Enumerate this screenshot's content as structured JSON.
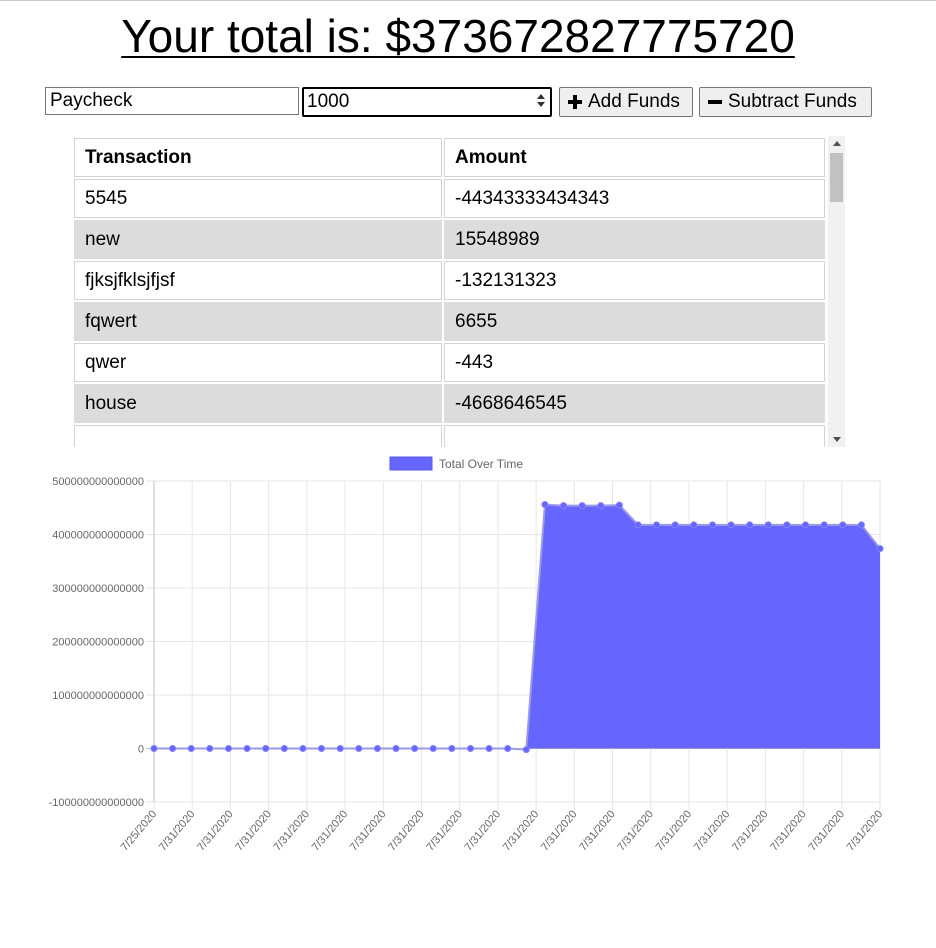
{
  "header": {
    "total_text": "Your total is: $373672827775720"
  },
  "form": {
    "name_value": "Paycheck",
    "amount_value": "1000",
    "add_label": "Add Funds",
    "subtract_label": "Subtract Funds"
  },
  "table": {
    "headers": [
      "Transaction",
      "Amount"
    ],
    "rows": [
      {
        "name": "5545",
        "amount": "-44343333434343"
      },
      {
        "name": "new",
        "amount": "15548989"
      },
      {
        "name": "fjksjfklsjfjsf",
        "amount": "-132131323"
      },
      {
        "name": "fqwert",
        "amount": "6655"
      },
      {
        "name": "qwer",
        "amount": "-443"
      },
      {
        "name": "house",
        "amount": "-4668646545"
      },
      {
        "name": "",
        "amount": ""
      }
    ]
  },
  "chart_data": {
    "type": "area",
    "legend": "Total Over Time",
    "legend_position": "top",
    "fill_color": "#6666ff",
    "ylim": [
      -100000000000000,
      500000000000000
    ],
    "yticks": [
      "500000000000000",
      "400000000000000",
      "300000000000000",
      "200000000000000",
      "100000000000000",
      "0",
      "-100000000000000"
    ],
    "x": [
      "7/25/2020",
      "7/31/2020",
      "7/31/2020",
      "7/31/2020",
      "7/31/2020",
      "7/31/2020",
      "7/31/2020",
      "7/31/2020",
      "7/31/2020",
      "7/31/2020",
      "7/31/2020",
      "7/31/2020",
      "7/31/2020",
      "7/31/2020",
      "7/31/2020",
      "7/31/2020",
      "7/31/2020",
      "7/31/2020",
      "7/31/2020",
      "7/31/2020",
      "7/31/2020",
      "7/31/2020",
      "7/31/2020",
      "7/31/2020",
      "7/31/2020",
      "7/31/2020",
      "7/31/2020",
      "7/31/2020",
      "7/31/2020",
      "7/31/2020",
      "7/31/2020",
      "7/31/2020",
      "7/31/2020",
      "7/31/2020",
      "7/31/2020",
      "7/31/2020",
      "7/31/2020",
      "7/31/2020",
      "7/31/2020",
      "7/31/2020"
    ],
    "xtick_labels": [
      "7/25/2020",
      "7/31/2020",
      "7/31/2020",
      "7/31/2020",
      "7/31/2020",
      "7/31/2020",
      "7/31/2020",
      "7/31/2020",
      "7/31/2020",
      "7/31/2020",
      "7/31/2020",
      "7/31/2020",
      "7/31/2020",
      "7/31/2020",
      "7/31/2020",
      "7/31/2020",
      "7/31/2020",
      "7/31/2020",
      "7/31/2020",
      "7/31/2020"
    ],
    "values": [
      0,
      0,
      0,
      0,
      0,
      0,
      0,
      0,
      0,
      0,
      0,
      0,
      0,
      0,
      0,
      0,
      0,
      0,
      0,
      0,
      -2000000000000,
      456000000000000,
      454000000000000,
      454000000000000,
      454000000000000,
      455000000000000,
      418000000000000,
      418000000000000,
      418000000000000,
      418000000000000,
      418000000000000,
      418000000000000,
      418000000000000,
      418000000000000,
      418000000000000,
      418000000000000,
      418000000000000,
      418000000000000,
      418000000000000,
      373672827775720
    ]
  }
}
